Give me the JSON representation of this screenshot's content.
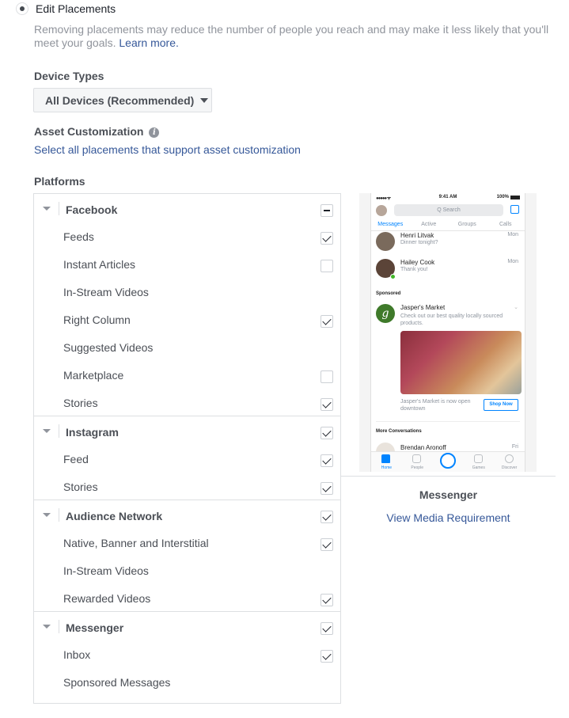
{
  "placement_option": {
    "label": "Edit Placements",
    "selected": true,
    "description": "Removing placements may reduce the number of people you reach and may make it less likely that you'll meet your goals.",
    "learn_more": "Learn more."
  },
  "device_types": {
    "label": "Device Types",
    "selected": "All Devices (Recommended)"
  },
  "asset_customization": {
    "label": "Asset Customization",
    "info_icon": "info-icon",
    "link": "Select all placements that support asset customization"
  },
  "platforms": {
    "label": "Platforms",
    "groups": [
      {
        "name": "Facebook",
        "state": "indeterminate",
        "items": [
          {
            "name": "Feeds",
            "state": "checked"
          },
          {
            "name": "Instant Articles",
            "state": "unchecked"
          },
          {
            "name": "In-Stream Videos",
            "state": "none"
          },
          {
            "name": "Right Column",
            "state": "checked"
          },
          {
            "name": "Suggested Videos",
            "state": "none"
          },
          {
            "name": "Marketplace",
            "state": "unchecked"
          },
          {
            "name": "Stories",
            "state": "checked"
          }
        ]
      },
      {
        "name": "Instagram",
        "state": "checked",
        "items": [
          {
            "name": "Feed",
            "state": "checked"
          },
          {
            "name": "Stories",
            "state": "checked"
          }
        ]
      },
      {
        "name": "Audience Network",
        "state": "checked",
        "items": [
          {
            "name": "Native, Banner and Interstitial",
            "state": "checked"
          },
          {
            "name": "In-Stream Videos",
            "state": "none"
          },
          {
            "name": "Rewarded Videos",
            "state": "checked"
          }
        ]
      },
      {
        "name": "Messenger",
        "state": "checked",
        "items": [
          {
            "name": "Inbox",
            "state": "checked"
          },
          {
            "name": "Sponsored Messages",
            "state": "none"
          }
        ]
      }
    ]
  },
  "preview": {
    "status_bar": {
      "signal": "●●●●● ᯤ",
      "time": "9:41 AM",
      "battery": "100%"
    },
    "search_placeholder": "Q Search",
    "tabs": [
      "Messages",
      "Active",
      "Groups",
      "Calls"
    ],
    "active_tab": "Messages",
    "conversations": [
      {
        "name": "Henri Litvak",
        "snippet": "Dinner tonight?",
        "when": "Mon"
      },
      {
        "name": "Hailey Cook",
        "snippet": "Thank you!",
        "when": "Mon"
      }
    ],
    "sponsored_label": "Sponsored",
    "ad": {
      "logo_letter": "g",
      "advertiser": "Jasper's Market",
      "text": "Check out our best quality locally sourced products.",
      "caption": "Jasper's Market is now open downtown",
      "cta": "Shop Now"
    },
    "more_conversations_label": "More Conversations",
    "more_conversation": {
      "name": "Brendan Aronoff",
      "when": "Fri"
    },
    "bottom_tabs": [
      "Home",
      "People",
      "",
      "Games",
      "Discover"
    ],
    "title": "Messenger",
    "media_link": "View Media Requirement"
  },
  "colors": {
    "link": "#365899",
    "muted_text": "#90949c",
    "label_text": "#4b4f56",
    "border": "#dddfe2",
    "messenger_blue": "#0084ff"
  }
}
